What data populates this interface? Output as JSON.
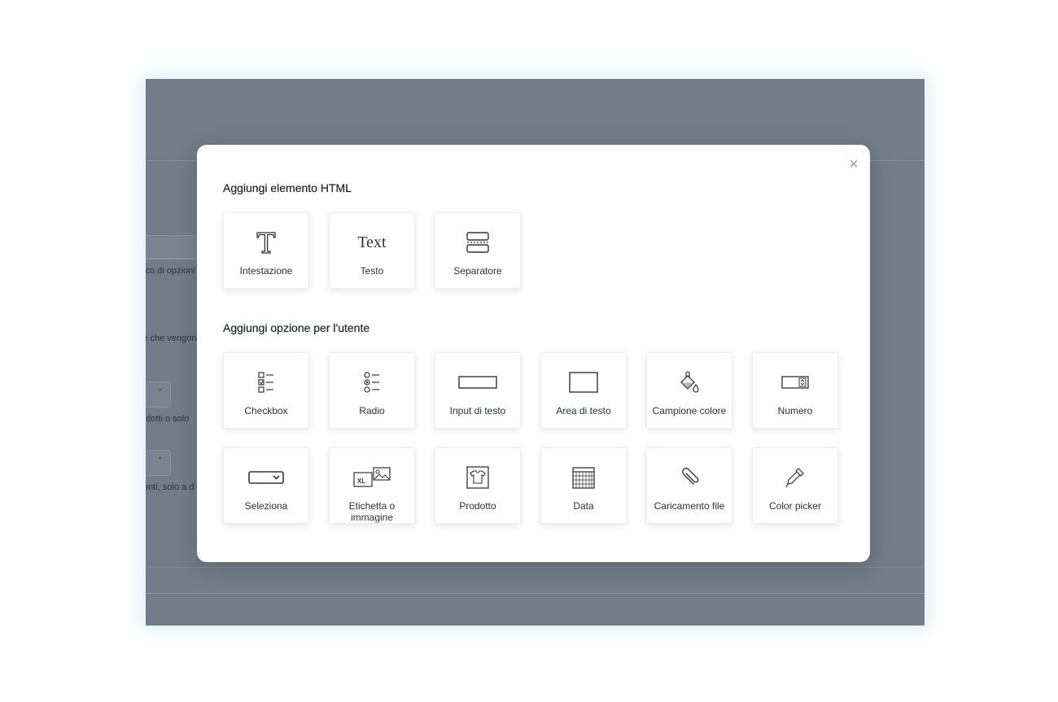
{
  "background": {
    "texts": [
      "cco di opzioni",
      "le che vengon",
      "odotti o solo",
      "tenti, solo a d"
    ]
  },
  "modal": {
    "close_label": "×",
    "html_section_title": "Aggiungi elemento HTML",
    "html_elements": [
      {
        "label": "Intestazione",
        "icon": "heading-icon"
      },
      {
        "label": "Testo",
        "icon": "text-icon",
        "glyph": "Text"
      },
      {
        "label": "Separatore",
        "icon": "separator-icon"
      }
    ],
    "option_section_title": "Aggiungi opzione per l'utente",
    "options_row1": [
      {
        "label": "Checkbox",
        "icon": "checkbox-icon"
      },
      {
        "label": "Radio",
        "icon": "radio-icon"
      },
      {
        "label": "Input di testo",
        "icon": "text-input-icon"
      },
      {
        "label": "Area di testo",
        "icon": "textarea-icon"
      },
      {
        "label": "Campione colore",
        "icon": "color-swatch-icon"
      },
      {
        "label": "Numero",
        "icon": "number-icon"
      }
    ],
    "options_row2": [
      {
        "label": "Seleziona",
        "icon": "select-icon"
      },
      {
        "label": "Etichetta o immagine",
        "icon": "label-image-icon",
        "badge": "XL"
      },
      {
        "label": "Prodotto",
        "icon": "product-icon"
      },
      {
        "label": "Data",
        "icon": "calendar-icon"
      },
      {
        "label": "Caricamento file",
        "icon": "paperclip-icon"
      },
      {
        "label": "Color picker",
        "icon": "eyedropper-icon"
      }
    ]
  }
}
